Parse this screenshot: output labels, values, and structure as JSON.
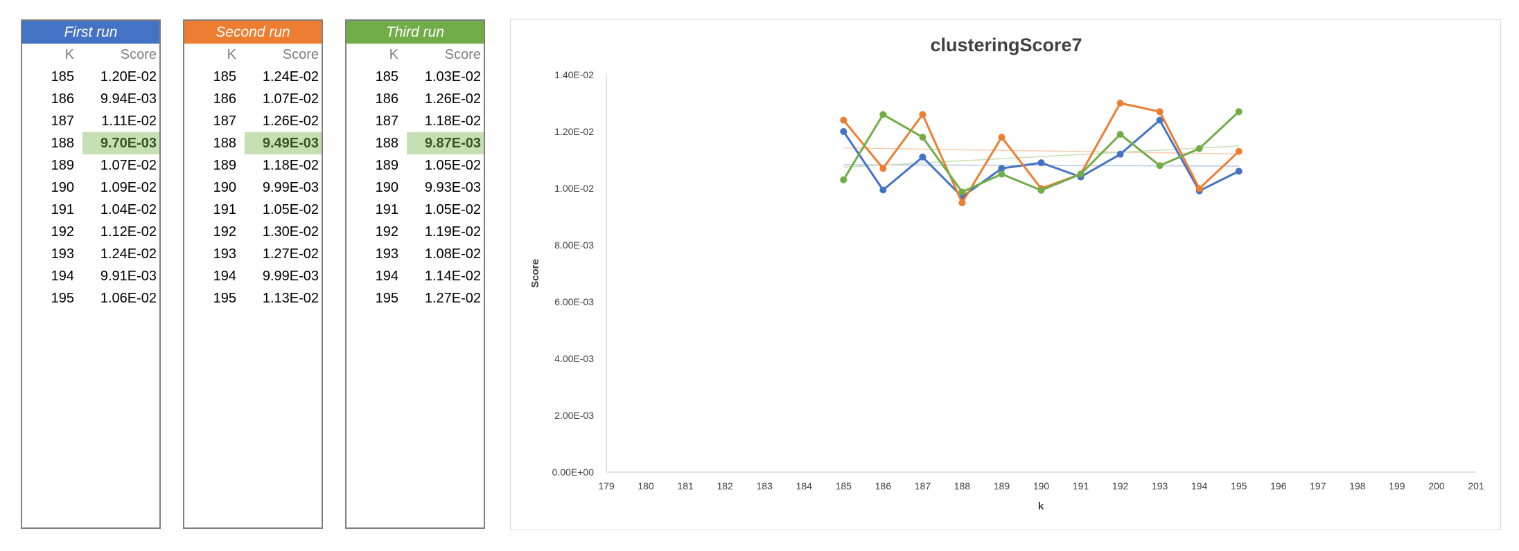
{
  "tables": [
    {
      "title": "First run",
      "color": "#4472c4",
      "k_label": "K",
      "score_label": "Score",
      "highlight_index": 3,
      "rows": [
        {
          "k": "185",
          "score": "1.20E-02"
        },
        {
          "k": "186",
          "score": "9.94E-03"
        },
        {
          "k": "187",
          "score": "1.11E-02"
        },
        {
          "k": "188",
          "score": "9.70E-03"
        },
        {
          "k": "189",
          "score": "1.07E-02"
        },
        {
          "k": "190",
          "score": "1.09E-02"
        },
        {
          "k": "191",
          "score": "1.04E-02"
        },
        {
          "k": "192",
          "score": "1.12E-02"
        },
        {
          "k": "193",
          "score": "1.24E-02"
        },
        {
          "k": "194",
          "score": "9.91E-03"
        },
        {
          "k": "195",
          "score": "1.06E-02"
        }
      ]
    },
    {
      "title": "Second run",
      "color": "#ed7d31",
      "k_label": "K",
      "score_label": "Score",
      "highlight_index": 3,
      "rows": [
        {
          "k": "185",
          "score": "1.24E-02"
        },
        {
          "k": "186",
          "score": "1.07E-02"
        },
        {
          "k": "187",
          "score": "1.26E-02"
        },
        {
          "k": "188",
          "score": "9.49E-03"
        },
        {
          "k": "189",
          "score": "1.18E-02"
        },
        {
          "k": "190",
          "score": "9.99E-03"
        },
        {
          "k": "191",
          "score": "1.05E-02"
        },
        {
          "k": "192",
          "score": "1.30E-02"
        },
        {
          "k": "193",
          "score": "1.27E-02"
        },
        {
          "k": "194",
          "score": "9.99E-03"
        },
        {
          "k": "195",
          "score": "1.13E-02"
        }
      ]
    },
    {
      "title": "Third run",
      "color": "#70ad47",
      "k_label": "K",
      "score_label": "Score",
      "highlight_index": 3,
      "rows": [
        {
          "k": "185",
          "score": "1.03E-02"
        },
        {
          "k": "186",
          "score": "1.26E-02"
        },
        {
          "k": "187",
          "score": "1.18E-02"
        },
        {
          "k": "188",
          "score": "9.87E-03"
        },
        {
          "k": "189",
          "score": "1.05E-02"
        },
        {
          "k": "190",
          "score": "9.93E-03"
        },
        {
          "k": "191",
          "score": "1.05E-02"
        },
        {
          "k": "192",
          "score": "1.19E-02"
        },
        {
          "k": "193",
          "score": "1.08E-02"
        },
        {
          "k": "194",
          "score": "1.14E-02"
        },
        {
          "k": "195",
          "score": "1.27E-02"
        }
      ]
    }
  ],
  "highlight_color": "#c6e0b4",
  "chart_data": {
    "type": "line",
    "title": "clusteringScore7",
    "xlabel": "k",
    "ylabel": "Score",
    "xlim": [
      179,
      201
    ],
    "x_ticks": [
      "179",
      "180",
      "181",
      "182",
      "183",
      "184",
      "185",
      "186",
      "187",
      "188",
      "189",
      "190",
      "191",
      "192",
      "193",
      "194",
      "195",
      "196",
      "197",
      "198",
      "199",
      "200",
      "201"
    ],
    "ylim": [
      0,
      0.014
    ],
    "y_ticks": [
      0,
      0.002,
      0.004,
      0.006,
      0.008,
      0.01,
      0.012,
      0.014
    ],
    "y_tick_labels": [
      "0.00E+00",
      "2.00E-03",
      "4.00E-03",
      "6.00E-03",
      "8.00E-03",
      "1.00E-02",
      "1.20E-02",
      "1.40E-02"
    ],
    "grid": false,
    "trendlines": true,
    "x": [
      185,
      186,
      187,
      188,
      189,
      190,
      191,
      192,
      193,
      194,
      195
    ],
    "series": [
      {
        "color": "#4472c4",
        "trend_color": "#b4c7e7",
        "values": [
          0.012,
          0.00994,
          0.0111,
          0.0097,
          0.0107,
          0.0109,
          0.0104,
          0.0112,
          0.0124,
          0.00991,
          0.0106
        ]
      },
      {
        "color": "#ed7d31",
        "trend_color": "#f8cbad",
        "values": [
          0.0124,
          0.0107,
          0.0126,
          0.00949,
          0.0118,
          0.00999,
          0.0105,
          0.013,
          0.0127,
          0.00999,
          0.0113
        ]
      },
      {
        "color": "#70ad47",
        "trend_color": "#c5e0b4",
        "values": [
          0.0103,
          0.0126,
          0.0118,
          0.00987,
          0.0105,
          0.00993,
          0.0105,
          0.0119,
          0.0108,
          0.0114,
          0.0127
        ]
      }
    ]
  }
}
